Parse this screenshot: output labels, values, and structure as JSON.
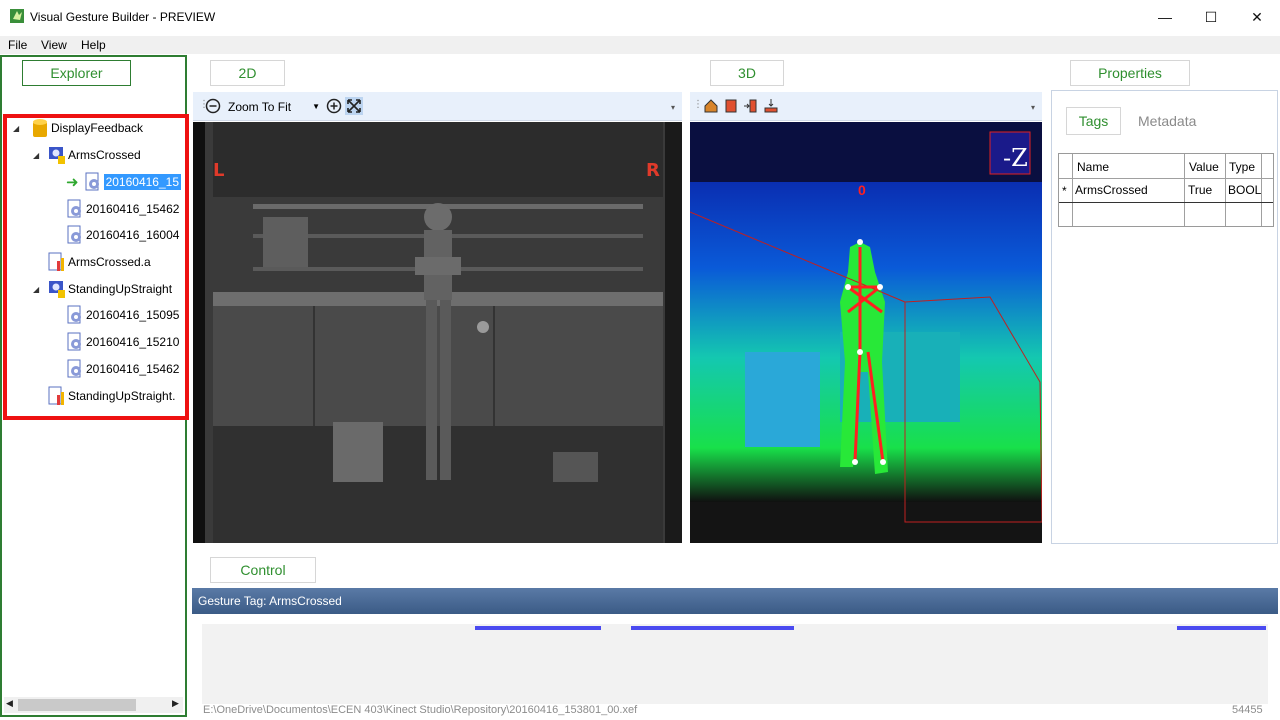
{
  "window": {
    "title": "Visual Gesture Builder - PREVIEW",
    "controls": {
      "minimize": "—",
      "maximize": "☐",
      "close": "✕"
    }
  },
  "menu": [
    "File",
    "View",
    "Help"
  ],
  "explorer": {
    "tab_label": "Explorer",
    "tree": [
      {
        "label": "DisplayFeedback",
        "icon": "solution-database-icon",
        "expander": "◢"
      },
      {
        "label": "ArmsCrossed",
        "icon": "gesture-project-icon",
        "expander": "◢"
      },
      {
        "label": "20160416_15",
        "icon": "clip-gear-icon",
        "active_arrow": "➜",
        "selected": true
      },
      {
        "label": "20160416_15462",
        "icon": "clip-gear-icon"
      },
      {
        "label": "20160416_16004",
        "icon": "clip-gear-icon"
      },
      {
        "label": "ArmsCrossed.a",
        "icon": "analysis-chart-icon"
      },
      {
        "label": "StandingUpStraight",
        "icon": "gesture-project-icon",
        "expander": "◢"
      },
      {
        "label": "20160416_15095",
        "icon": "clip-gear-icon"
      },
      {
        "label": "20160416_15210",
        "icon": "clip-gear-icon"
      },
      {
        "label": "20160416_15462",
        "icon": "clip-gear-icon"
      },
      {
        "label": "StandingUpStraight.",
        "icon": "analysis-chart-icon"
      }
    ],
    "scroll_left": "◀",
    "scroll_right": "▶"
  },
  "view2d": {
    "tab_label": "2D",
    "toolbar": {
      "zoom_out_icon": "zoom-out-icon",
      "zoom_value": "Zoom To Fit",
      "zoom_in_icon": "zoom-in-icon",
      "fit_icon": "fit-to-window-icon"
    },
    "label_left": "L",
    "label_right": "R"
  },
  "view3d": {
    "tab_label": "3D",
    "toolbar_icons": [
      "home-view-icon",
      "front-view-icon",
      "side-view-icon",
      "top-view-icon"
    ],
    "orientation_cube_label": "-Z",
    "body_index": "0"
  },
  "properties": {
    "tab_label": "Properties",
    "tabs": [
      "Tags",
      "Metadata"
    ],
    "grid": {
      "columns": [
        "Name",
        "Value",
        "Type"
      ],
      "rows": [
        {
          "marker": "*",
          "name": "ArmsCrossed",
          "value": "True",
          "type": "BOOL"
        }
      ]
    }
  },
  "control": {
    "tab_label": "Control",
    "gesture_tag": "Gesture Tag: ArmsCrossed",
    "file_path": "E:\\OneDrive\\Documentos\\ECEN 403\\Kinect Studio\\Repository\\20160416_153801_00.xef",
    "frame_count": "54455",
    "segment_color": "#4a4af0",
    "timeline_segments": [
      {
        "start_fraction": 0.256,
        "end_fraction": 0.374
      },
      {
        "start_fraction": 0.402,
        "end_fraction": 0.555
      },
      {
        "start_fraction": 0.915,
        "end_fraction": 0.998
      }
    ]
  },
  "colors": {
    "panel_tab_text": "#2f8f2f",
    "explorer_border": "#2e7d32",
    "highlight_box": "#ee1111",
    "control_bar": "#4a6a96",
    "toolbar_bg": "#e8f0fb"
  }
}
